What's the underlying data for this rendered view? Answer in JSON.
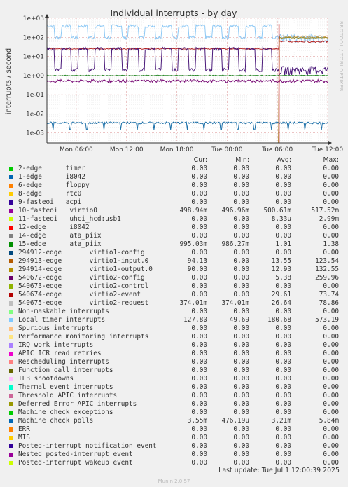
{
  "title": "Individual interrupts - by day",
  "ylabel": "interrupts / second",
  "side_label": "RRDTOOL / TOBI OETIKER",
  "munin_version": "Munin 2.0.57",
  "last_update": "Last update: Tue Jul  1 12:00:39 2025",
  "headers": [
    "Cur:",
    "Min:",
    "Avg:",
    "Max:"
  ],
  "colors": {
    "bg": "#f0f0f0",
    "plot_bg": "#ffffff",
    "grid_major": "#e0a0a0",
    "grid_minor": "#ececec",
    "axis": "#333333",
    "accent": "#c00000"
  },
  "chart_data": {
    "type": "line",
    "title": "Individual interrupts - by day",
    "ylabel": "interrupts / second",
    "xlabel": "",
    "yscale": "log",
    "ylim": [
      0.0003,
      1000
    ],
    "y_ticks": [
      "1e-03",
      "1e-02",
      "1e-01",
      "1e+00",
      "1e+01",
      "1e+02",
      "1e+03"
    ],
    "x_ticks": [
      "Mon 06:00",
      "Mon 12:00",
      "Mon 18:00",
      "Tue 00:00",
      "Tue 06:00",
      "Tue 12:00"
    ],
    "x_range_hours": [
      2.5,
      36
    ],
    "grid": true,
    "legend_position": "below",
    "series": [
      {
        "name": "Local timer interrupts",
        "color": "#8ec9f5",
        "baseline": 100,
        "peak": 470,
        "pattern": "blocks"
      },
      {
        "name": "virtio2-request",
        "color": "#b22222",
        "baseline": 25,
        "peak": 60,
        "pattern": "steady"
      },
      {
        "name": "virtio1-input.0",
        "color": "#c67d12",
        "baseline": 0,
        "peak": 120,
        "pattern": "late-step"
      },
      {
        "name": "virtio1-output.0",
        "color": "#9e8a22",
        "baseline": 0,
        "peak": 100,
        "pattern": "late-step"
      },
      {
        "name": "virtio2-config",
        "color": "#4b1a7a",
        "baseline": 2,
        "peak": 30,
        "pattern": "blocks"
      },
      {
        "name": "virtio0",
        "color": "#7a0c77",
        "baseline": 0.5,
        "peak": 0.52,
        "pattern": "noisy"
      },
      {
        "name": "15-edge ata_piix",
        "color": "#2e8b2e",
        "baseline": 1.0,
        "peak": 1.38,
        "pattern": "steady"
      },
      {
        "name": "Machine check polls",
        "color": "#1b6fa8",
        "baseline": 0.0033,
        "peak": 0.0058,
        "pattern": "dips"
      }
    ],
    "table": [
      {
        "name": "2-edge      timer",
        "color": "#00cc00",
        "cur": "0.00",
        "min": "0.00",
        "avg": "0.00",
        "max": "0.00"
      },
      {
        "name": "1-edge      i8042",
        "color": "#0066b3",
        "cur": "0.00",
        "min": "0.00",
        "avg": "0.00",
        "max": "0.00"
      },
      {
        "name": "6-edge      floppy",
        "color": "#ff8000",
        "cur": "0.00",
        "min": "0.00",
        "avg": "0.00",
        "max": "0.00"
      },
      {
        "name": "8-edge      rtc0",
        "color": "#ffcc00",
        "cur": "0.00",
        "min": "0.00",
        "avg": "0.00",
        "max": "0.00"
      },
      {
        "name": "9-fasteoi   acpi",
        "color": "#330099",
        "cur": "0.00",
        "min": "0.00",
        "avg": "0.00",
        "max": "0.00"
      },
      {
        "name": "10-fasteoi   virtio0",
        "color": "#990099",
        "cur": "498.94m",
        "min": "496.96m",
        "avg": "500.61m",
        "max": "517.52m"
      },
      {
        "name": "11-fasteoi   uhci_hcd:usb1",
        "color": "#ccff00",
        "cur": "0.00",
        "min": "0.00",
        "avg": "8.33u",
        "max": "2.99m"
      },
      {
        "name": "12-edge      i8042",
        "color": "#ff0000",
        "cur": "0.00",
        "min": "0.00",
        "avg": "0.00",
        "max": "0.00"
      },
      {
        "name": "14-edge      ata_piix",
        "color": "#808080",
        "cur": "0.00",
        "min": "0.00",
        "avg": "0.00",
        "max": "0.00"
      },
      {
        "name": "15-edge      ata_piix",
        "color": "#008f00",
        "cur": "995.03m",
        "min": "986.27m",
        "avg": "1.01",
        "max": "1.38"
      },
      {
        "name": "294912-edge       virtio1-config",
        "color": "#00487d",
        "cur": "0.00",
        "min": "0.00",
        "avg": "0.00",
        "max": "0.00"
      },
      {
        "name": "294913-edge       virtio1-input.0",
        "color": "#b35a00",
        "cur": "94.13",
        "min": "0.00",
        "avg": "13.55",
        "max": "123.54"
      },
      {
        "name": "294914-edge       virtio1-output.0",
        "color": "#b38f00",
        "cur": "90.03",
        "min": "0.00",
        "avg": "12.93",
        "max": "132.55"
      },
      {
        "name": "540672-edge       virtio2-config",
        "color": "#6b006b",
        "cur": "0.00",
        "min": "0.00",
        "avg": "5.38",
        "max": "259.96"
      },
      {
        "name": "540673-edge       virtio2-control",
        "color": "#8fb300",
        "cur": "0.00",
        "min": "0.00",
        "avg": "0.00",
        "max": "0.00"
      },
      {
        "name": "540674-edge       virtio2-event",
        "color": "#b30000",
        "cur": "0.00",
        "min": "0.00",
        "avg": "29.61",
        "max": "73.74"
      },
      {
        "name": "540675-edge       virtio2-request",
        "color": "#bebebe",
        "cur": "374.01m",
        "min": "374.01m",
        "avg": "26.64",
        "max": "78.86"
      },
      {
        "name": "Non-maskable interrupts",
        "color": "#80ff80",
        "cur": "0.00",
        "min": "0.00",
        "avg": "0.00",
        "max": "0.00"
      },
      {
        "name": "Local timer interrupts",
        "color": "#80c9ff",
        "cur": "127.80",
        "min": "49.69",
        "avg": "180.68",
        "max": "573.19"
      },
      {
        "name": "Spurious interrupts",
        "color": "#ffc080",
        "cur": "0.00",
        "min": "0.00",
        "avg": "0.00",
        "max": "0.00"
      },
      {
        "name": "Performance monitoring interrupts",
        "color": "#ffe680",
        "cur": "0.00",
        "min": "0.00",
        "avg": "0.00",
        "max": "0.00"
      },
      {
        "name": "IRQ work interrupts",
        "color": "#aa80ff",
        "cur": "0.00",
        "min": "0.00",
        "avg": "0.00",
        "max": "0.00"
      },
      {
        "name": "APIC ICR read retries",
        "color": "#ee00cc",
        "cur": "0.00",
        "min": "0.00",
        "avg": "0.00",
        "max": "0.00"
      },
      {
        "name": "Rescheduling interrupts",
        "color": "#ff8080",
        "cur": "0.00",
        "min": "0.00",
        "avg": "0.00",
        "max": "0.00"
      },
      {
        "name": "Function call interrupts",
        "color": "#666600",
        "cur": "0.00",
        "min": "0.00",
        "avg": "0.00",
        "max": "0.00"
      },
      {
        "name": "TLB shootdowns",
        "color": "#ffbfff",
        "cur": "0.00",
        "min": "0.00",
        "avg": "0.00",
        "max": "0.00"
      },
      {
        "name": "Thermal event interrupts",
        "color": "#00ffcc",
        "cur": "0.00",
        "min": "0.00",
        "avg": "0.00",
        "max": "0.00"
      },
      {
        "name": "Threshold APIC interrupts",
        "color": "#cc6699",
        "cur": "0.00",
        "min": "0.00",
        "avg": "0.00",
        "max": "0.00"
      },
      {
        "name": "Deferred Error APIC interrupts",
        "color": "#999900",
        "cur": "0.00",
        "min": "0.00",
        "avg": "0.00",
        "max": "0.00"
      },
      {
        "name": "Machine check exceptions",
        "color": "#00cc00",
        "cur": "0.00",
        "min": "0.00",
        "avg": "0.00",
        "max": "0.00"
      },
      {
        "name": "Machine check polls",
        "color": "#0066b3",
        "cur": "3.55m",
        "min": "476.19u",
        "avg": "3.21m",
        "max": "5.84m"
      },
      {
        "name": "ERR",
        "color": "#ff8000",
        "cur": "0.00",
        "min": "0.00",
        "avg": "0.00",
        "max": "0.00"
      },
      {
        "name": "MIS",
        "color": "#ffcc00",
        "cur": "0.00",
        "min": "0.00",
        "avg": "0.00",
        "max": "0.00"
      },
      {
        "name": "Posted-interrupt notification event",
        "color": "#330099",
        "cur": "0.00",
        "min": "0.00",
        "avg": "0.00",
        "max": "0.00"
      },
      {
        "name": "Nested posted-interrupt event",
        "color": "#990099",
        "cur": "0.00",
        "min": "0.00",
        "avg": "0.00",
        "max": "0.00"
      },
      {
        "name": "Posted-interrupt wakeup event",
        "color": "#ccff00",
        "cur": "0.00",
        "min": "0.00",
        "avg": "0.00",
        "max": "0.00"
      }
    ]
  }
}
